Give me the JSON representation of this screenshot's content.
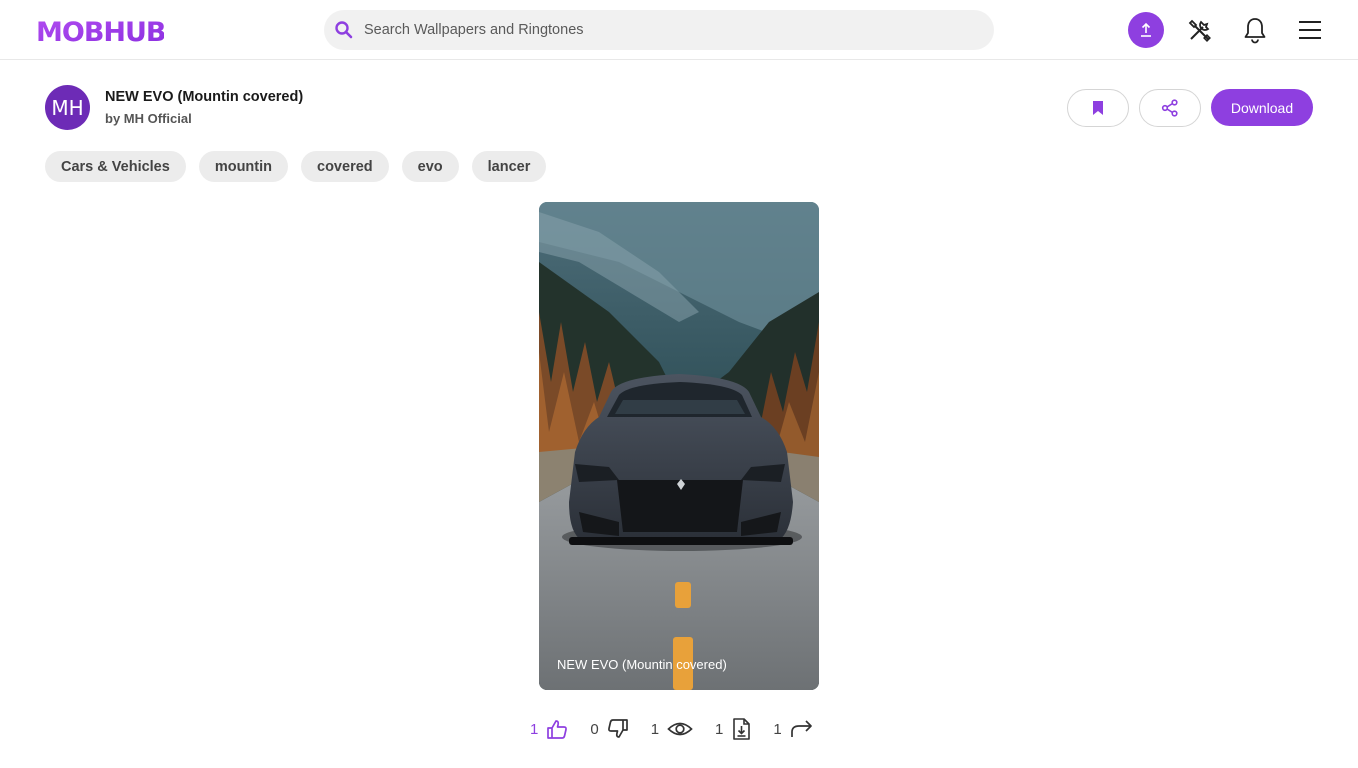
{
  "header": {
    "logo_text": "MOBHUB",
    "search_placeholder": "Search Wallpapers and Ringtones",
    "icons": [
      "upload-icon",
      "tools-icon",
      "bell-icon",
      "menu-icon"
    ]
  },
  "wallpaper": {
    "title": "NEW EVO (Mountin covered)",
    "author": "by MH Official",
    "avatar_initials": "MH",
    "download_label": "Download",
    "caption": "NEW EVO (Mountin covered)"
  },
  "tags": [
    "Cars & Vehicles",
    "mountin",
    "covered",
    "evo",
    "lancer"
  ],
  "stats": {
    "likes": "1",
    "dislikes": "0",
    "views": "1",
    "downloads": "1",
    "shares": "1"
  },
  "colors": {
    "accent": "#8e3fe0",
    "avatar": "#6d2bb6",
    "tag_bg": "#ececec"
  }
}
